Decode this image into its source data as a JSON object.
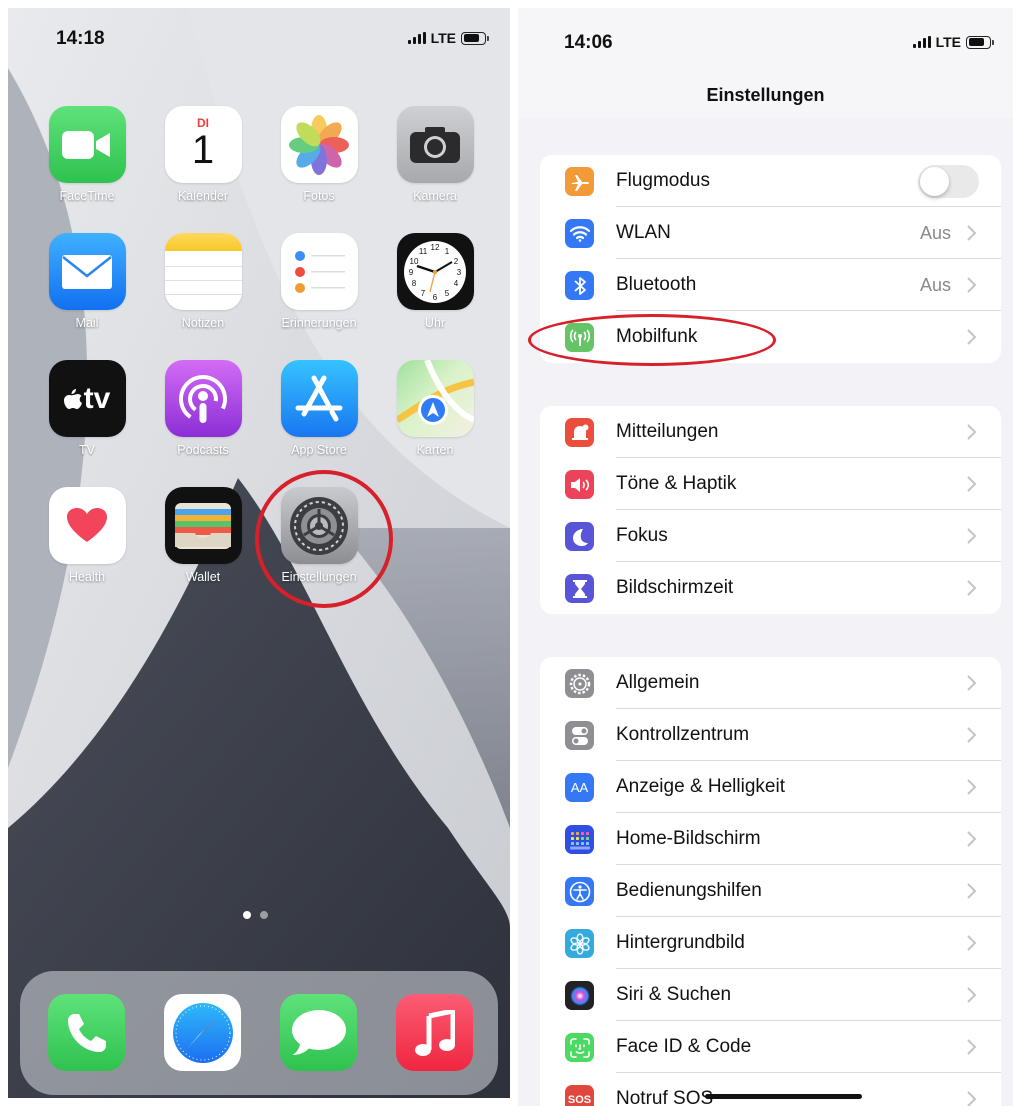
{
  "home_screen": {
    "status": {
      "time": "14:18",
      "network": "LTE"
    },
    "apps": [
      {
        "label": "FaceTime",
        "icon": "facetime-icon"
      },
      {
        "label": "Kalender",
        "icon": "calendar-icon",
        "weekday": "DI",
        "day": "1"
      },
      {
        "label": "Fotos",
        "icon": "photos-icon"
      },
      {
        "label": "Kamera",
        "icon": "camera-icon"
      },
      {
        "label": "Mail",
        "icon": "mail-icon"
      },
      {
        "label": "Notizen",
        "icon": "notes-icon"
      },
      {
        "label": "Erinnerungen",
        "icon": "reminders-icon"
      },
      {
        "label": "Uhr",
        "icon": "clock-icon"
      },
      {
        "label": "TV",
        "icon": "appletv-icon",
        "icon_text": "tv"
      },
      {
        "label": "Podcasts",
        "icon": "podcasts-icon"
      },
      {
        "label": "App Store",
        "icon": "app-store-icon"
      },
      {
        "label": "Karten",
        "icon": "maps-icon"
      },
      {
        "label": "Health",
        "icon": "health-icon"
      },
      {
        "label": "Wallet",
        "icon": "wallet-icon"
      },
      {
        "label": "Einstellungen",
        "icon": "settings-gear-icon"
      }
    ],
    "dock": [
      "phone-icon",
      "safari-icon",
      "messages-icon",
      "music-icon"
    ],
    "page_count": 2,
    "current_page": 1,
    "highlight": "Einstellungen"
  },
  "settings_screen": {
    "status": {
      "time": "14:06",
      "network": "LTE"
    },
    "title": "Einstellungen",
    "groups": [
      [
        {
          "label": "Flugmodus",
          "icon": "airplane-icon",
          "color": "#f19a37",
          "control": "toggle",
          "toggle_on": false
        },
        {
          "label": "WLAN",
          "icon": "wifi-icon",
          "color": "#3478f6",
          "value": "Aus"
        },
        {
          "label": "Bluetooth",
          "icon": "bluetooth-icon",
          "color": "#3478f6",
          "value": "Aus"
        },
        {
          "label": "Mobilfunk",
          "icon": "antenna-icon",
          "color": "#65c466"
        }
      ],
      [
        {
          "label": "Mitteilungen",
          "icon": "notifications-icon",
          "color": "#eb4e3d"
        },
        {
          "label": "Töne & Haptik",
          "icon": "speaker-icon",
          "color": "#eb445a"
        },
        {
          "label": "Fokus",
          "icon": "moon-icon",
          "color": "#5856d6"
        },
        {
          "label": "Bildschirmzeit",
          "icon": "hourglass-icon",
          "color": "#5856d6"
        }
      ],
      [
        {
          "label": "Allgemein",
          "icon": "gear-icon",
          "color": "#8e8e93"
        },
        {
          "label": "Kontrollzentrum",
          "icon": "switches-icon",
          "color": "#8e8e93"
        },
        {
          "label": "Anzeige & Helligkeit",
          "icon": "text-size-icon",
          "color": "#3478f6",
          "icon_text": "AA"
        },
        {
          "label": "Home-Bildschirm",
          "icon": "home-grid-icon",
          "color": "#2e4fe0"
        },
        {
          "label": "Bedienungshilfen",
          "icon": "accessibility-icon",
          "color": "#3478f6"
        },
        {
          "label": "Hintergrundbild",
          "icon": "flower-icon",
          "color": "#35aadc"
        },
        {
          "label": "Siri & Suchen",
          "icon": "siri-icon",
          "color": "#222222"
        },
        {
          "label": "Face ID & Code",
          "icon": "face-id-icon",
          "color": "#4cd964"
        },
        {
          "label": "Notruf SOS",
          "icon": "sos-icon",
          "color": "#e0483e",
          "icon_text": "SOS"
        }
      ]
    ],
    "highlight": "Mobilfunk"
  }
}
